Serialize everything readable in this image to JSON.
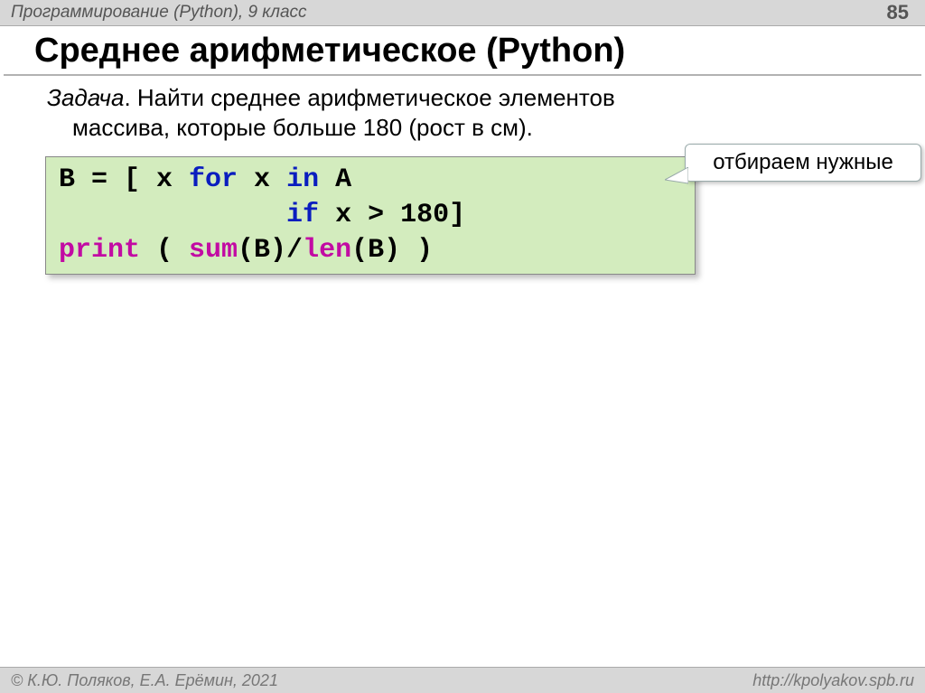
{
  "header": {
    "course": "Программирование (Python), 9 класс",
    "page": "85"
  },
  "title": "Среднее арифметическое (Python)",
  "task": {
    "label": "Задача",
    "sep": ". ",
    "line1_rest": "Найти среднее арифметическое элементов",
    "line2": "массива, которые больше 180 (рост в см)."
  },
  "code": {
    "l1_a": "B = [ x ",
    "l1_kw1": "for",
    "l1_b": " x ",
    "l1_kw2": "in",
    "l1_c": " A",
    "l2_pad": "              ",
    "l2_kw": "if",
    "l2_b": " x > 180]",
    "l3_fn1": "print",
    "l3_a": " ( ",
    "l3_fn2": "sum",
    "l3_b": "(B)/",
    "l3_fn3": "len",
    "l3_c": "(B) )"
  },
  "callout": "отбираем нужные",
  "footer": {
    "copyright": "© К.Ю. Поляков, Е.А. Ерёмин, 2021",
    "url": "http://kpolyakov.spb.ru"
  }
}
